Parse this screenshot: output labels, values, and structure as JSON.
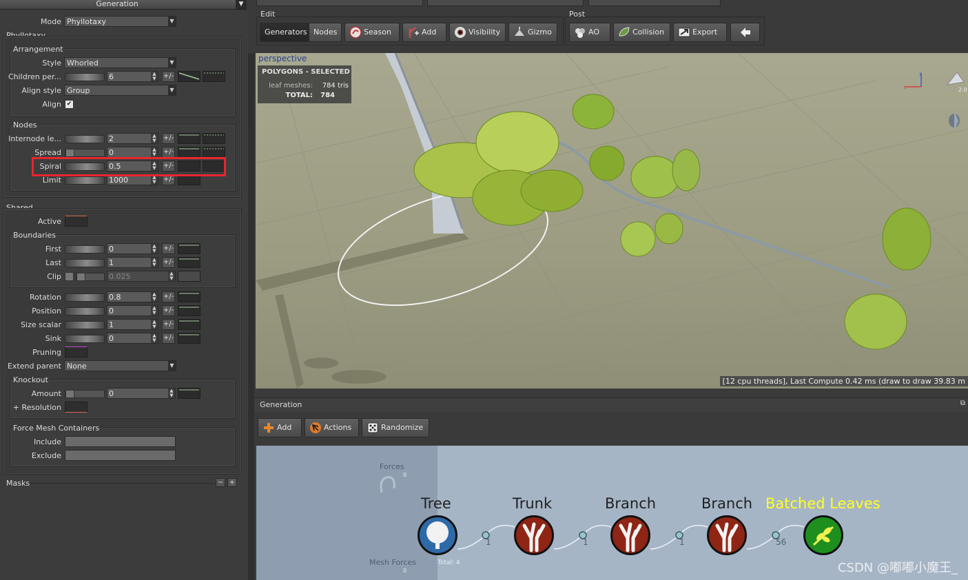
{
  "left_panel": {
    "header_title": "Generation",
    "mode_label": "Mode",
    "mode_value": "Phyllotaxy",
    "phyllotaxy_title": "Phyllotaxy",
    "arrangement": {
      "title": "Arrangement",
      "style_label": "Style",
      "style_value": "Whorled",
      "children_label": "Children per...",
      "children_value": "6",
      "align_style_label": "Align style",
      "align_style_value": "Group",
      "align_label": "Align",
      "align_checked": true
    },
    "nodes": {
      "title": "Nodes",
      "internode_label": "Internode le...",
      "internode_value": "2",
      "spread_label": "Spread",
      "spread_value": "0",
      "spiral_label": "Spiral",
      "spiral_value": "0.5",
      "limit_label": "Limit",
      "limit_value": "1000"
    },
    "pm_label": "+/-",
    "shared": {
      "title": "Shared",
      "active_label": "Active",
      "boundaries_title": "Boundaries",
      "first_label": "First",
      "first_value": "0",
      "last_label": "Last",
      "last_value": "1",
      "clip_label": "Clip",
      "clip_value": "0.025",
      "rotation_label": "Rotation",
      "rotation_value": "0.8",
      "position_label": "Position",
      "position_value": "0",
      "size_label": "Size scalar",
      "size_value": "1",
      "sink_label": "Sink",
      "sink_value": "0",
      "pruning_label": "Pruning",
      "extend_label": "Extend parent",
      "extend_value": "None",
      "knockout_title": "Knockout",
      "amount_label": "Amount",
      "amount_value": "0",
      "resolution_label": "+ Resolution"
    },
    "force_mesh": {
      "title": "Force Mesh Containers",
      "include_label": "Include",
      "exclude_label": "Exclude"
    },
    "masks_label": "Masks"
  },
  "toolbar": {
    "edit_title": "Edit",
    "post_title": "Post",
    "edit_buttons": [
      "Generators",
      "Nodes",
      "Season",
      "Add",
      "Visibility",
      "Gizmo"
    ],
    "post_buttons": [
      "AO",
      "Collision",
      "Export"
    ]
  },
  "viewport": {
    "label": "perspective",
    "poly_title": "POLYGONS - SELECTED",
    "leaf_label": "leaf meshes:",
    "leaf_value": "784 tris",
    "total_label": "TOTAL:",
    "total_value": "784",
    "axis_value": "2.0",
    "status": "[12 cpu threads], Last Compute 0.42 ms (draw to draw 39.83 m"
  },
  "bottom": {
    "title": "Generation",
    "buttons": [
      "Add",
      "Actions",
      "Randomize"
    ],
    "forces_label": "Forces",
    "forces_count": "0",
    "mesh_forces_label": "Mesh Forces",
    "mesh_forces_count": "0",
    "total_label": "Total: 4",
    "nodes": [
      "Tree",
      "Trunk",
      "Branch",
      "Branch",
      "Batched Leaves"
    ],
    "counts": [
      "1",
      "1",
      "1",
      "56"
    ],
    "watermark": "CSDN @嘟嘟小魔王_"
  },
  "colors": {
    "highlight_box": "#e8262f",
    "batched_leaves_label": "#ffff22",
    "viewport_label": "#2c3f8f"
  }
}
